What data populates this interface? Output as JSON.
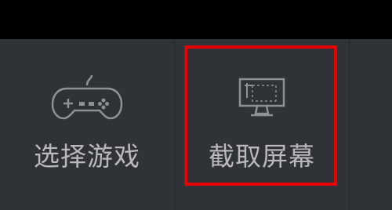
{
  "toolbar": {
    "buttons": [
      {
        "label": "选择游戏",
        "icon": "gamepad-icon"
      },
      {
        "label": "截取屏幕",
        "icon": "monitor-capture-icon"
      }
    ]
  },
  "colors": {
    "background": "#2f3237",
    "label": "#b7b9bd",
    "highlight": "#e60000"
  }
}
